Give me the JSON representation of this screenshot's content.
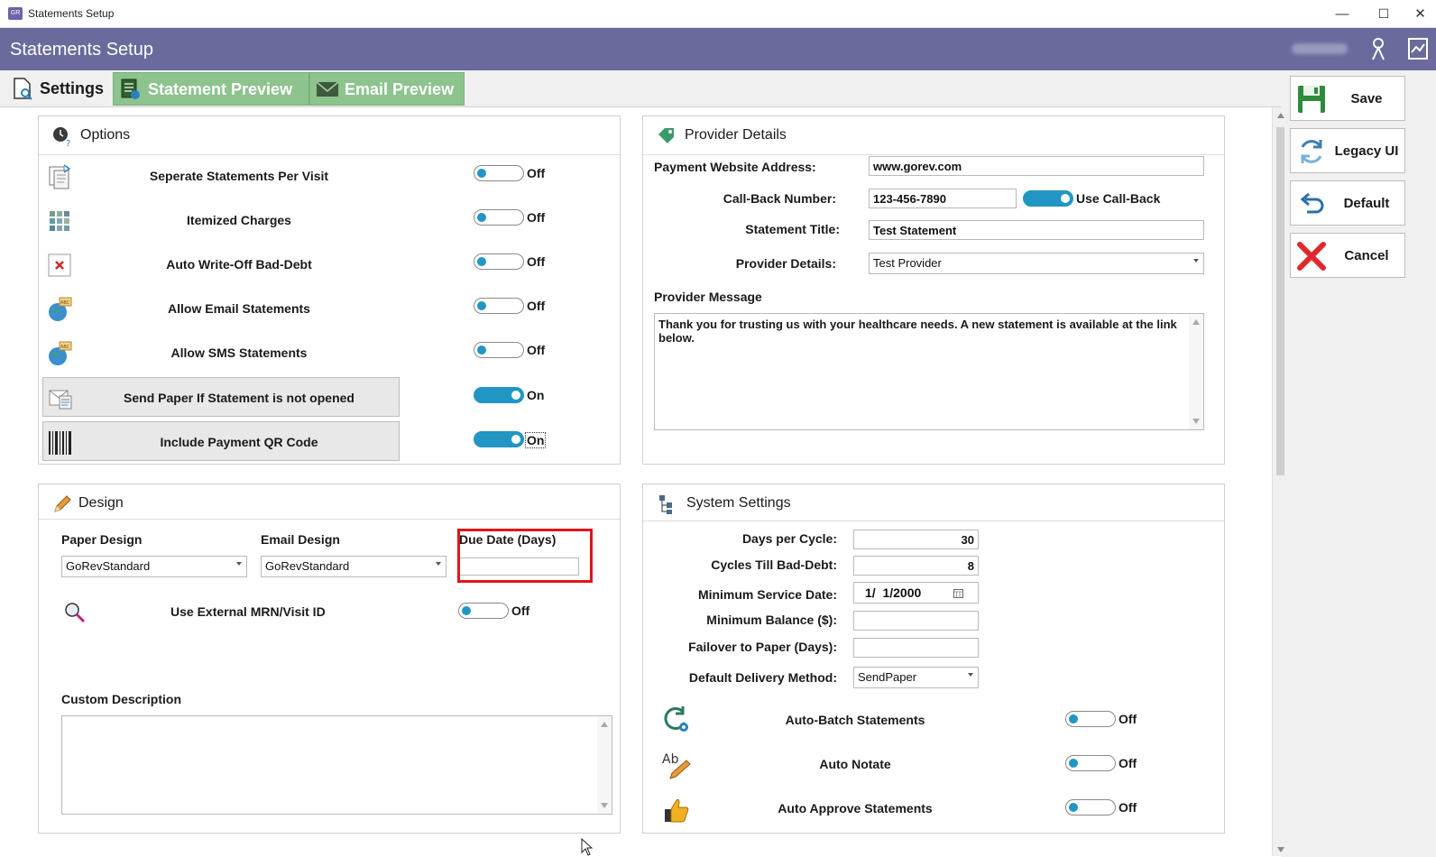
{
  "window": {
    "title": "Statements Setup",
    "minimize": "—",
    "maximize": "☐",
    "close": "✕"
  },
  "header": {
    "title": "Statements Setup"
  },
  "tabs": [
    {
      "label": "Settings",
      "icon": "settings-doc-icon"
    },
    {
      "label": "Statement Preview",
      "icon": "statement-preview-icon"
    },
    {
      "label": "Email Preview",
      "icon": "envelope-icon"
    }
  ],
  "options": {
    "title": "Options",
    "rows": [
      {
        "label": "Seperate Statements Per Visit",
        "state": "Off"
      },
      {
        "label": "Itemized Charges",
        "state": "Off"
      },
      {
        "label": "Auto Write-Off Bad-Debt",
        "state": "Off"
      },
      {
        "label": "Allow Email Statements",
        "state": "Off"
      },
      {
        "label": "Allow SMS Statements",
        "state": "Off"
      },
      {
        "label": "Send Paper If Statement is not opened",
        "state": "On"
      },
      {
        "label": "Include Payment QR Code",
        "state": "On"
      }
    ]
  },
  "provider": {
    "title": "Provider Details",
    "website_label": "Payment Website Address:",
    "website_value": "www.gorev.com",
    "callback_label": "Call-Back Number:",
    "callback_value": "123-456-7890",
    "use_callback_label": "Use Call-Back",
    "statement_title_label": "Statement Title:",
    "statement_title_value": "Test Statement",
    "provider_details_label": "Provider Details:",
    "provider_details_value": "Test Provider",
    "message_label": "Provider Message",
    "message_value": "Thank you for trusting us with your healthcare needs.  A new statement is available at the link below."
  },
  "design": {
    "title": "Design",
    "paper_label": "Paper Design",
    "paper_value": "GoRevStandard",
    "email_label": "Email Design",
    "email_value": "GoRevStandard",
    "due_label": "Due Date (Days)",
    "due_value": "",
    "mrn_label": "Use External MRN/Visit ID",
    "mrn_state": "Off",
    "custom_label": "Custom Description",
    "custom_value": ""
  },
  "system": {
    "title": "System Settings",
    "days_label": "Days per Cycle:",
    "days_value": "30",
    "cycles_label": "Cycles Till Bad-Debt:",
    "cycles_value": "8",
    "min_date_label": "Minimum Service Date:",
    "min_date_value": "1/  1/2000",
    "min_balance_label": "Minimum Balance ($):",
    "min_balance_value": "",
    "failover_label": "Failover to Paper (Days):",
    "failover_value": "",
    "delivery_label": "Default Delivery Method:",
    "delivery_value": "SendPaper",
    "rows": [
      {
        "label": "Auto-Batch Statements",
        "state": "Off"
      },
      {
        "label": "Auto Notate",
        "state": "Off"
      },
      {
        "label": "Auto Approve Statements",
        "state": "Off"
      }
    ]
  },
  "actions": {
    "save": "Save",
    "legacy": "Legacy UI",
    "default": "Default",
    "cancel": "Cancel"
  },
  "colors": {
    "header": "#6a6a9c",
    "tab_green": "#8dc38d",
    "toggle_blue": "#2196c4",
    "highlight_red": "#e0151b"
  }
}
